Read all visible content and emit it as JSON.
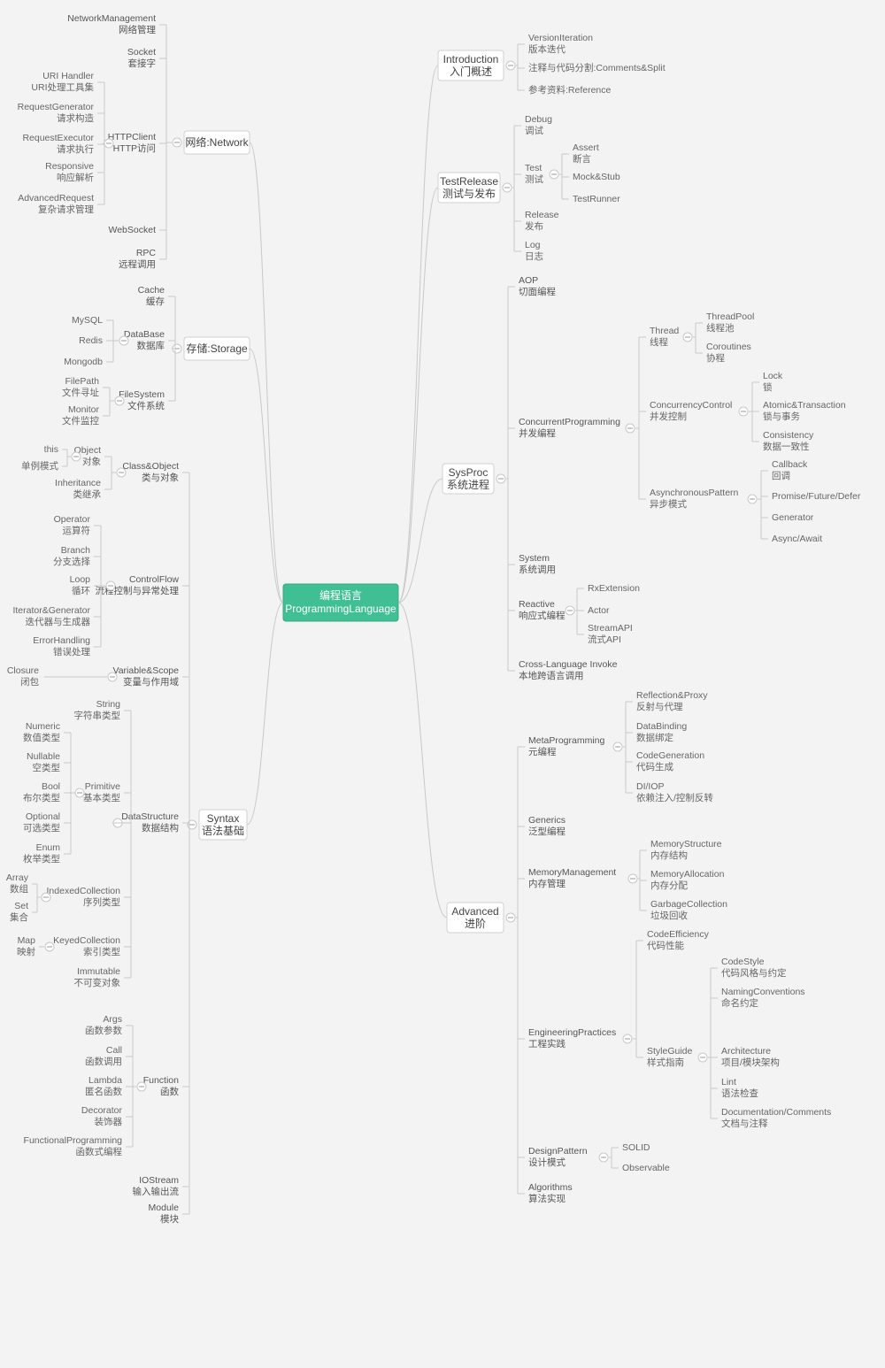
{
  "root": {
    "l1": "编程语言",
    "l2": "ProgrammingLanguage"
  },
  "left": {
    "network": {
      "l1": "网络:Network",
      "children": [
        {
          "l1": "NetworkManagement",
          "l2": "网络管理"
        },
        {
          "l1": "Socket",
          "l2": "套接字"
        },
        {
          "l1": "HTTPClient",
          "l2": "HTTP访问",
          "children": [
            {
              "l1": "URI Handler",
              "l2": "URI处理工具集"
            },
            {
              "l1": "RequestGenerator",
              "l2": "请求构造"
            },
            {
              "l1": "RequestExecutor",
              "l2": "请求执行"
            },
            {
              "l1": "Responsive",
              "l2": "响应解析"
            },
            {
              "l1": "AdvancedRequest",
              "l2": "复杂请求管理"
            }
          ]
        },
        {
          "l1": "WebSocket"
        },
        {
          "l1": "RPC",
          "l2": "远程调用"
        }
      ]
    },
    "storage": {
      "l1": "存储:Storage",
      "children": [
        {
          "l1": "Cache",
          "l2": "缓存"
        },
        {
          "l1": "DataBase",
          "l2": "数据库",
          "children": [
            {
              "l1": "MySQL"
            },
            {
              "l1": "Redis"
            },
            {
              "l1": "Mongodb"
            }
          ]
        },
        {
          "l1": "FileSystem",
          "l2": "文件系统",
          "children": [
            {
              "l1": "FilePath",
              "l2": "文件寻址"
            },
            {
              "l1": "Monitor",
              "l2": "文件监控"
            }
          ]
        }
      ]
    },
    "syntax": {
      "l1": "Syntax",
      "l2": "语法基础",
      "children": [
        {
          "l1": "Class&Object",
          "l2": "类与对象",
          "children": [
            {
              "l1": "Object",
              "l2": "对象",
              "children": [
                {
                  "l1": "this"
                },
                {
                  "l1": "单例模式"
                }
              ]
            },
            {
              "l1": "Inheritance",
              "l2": "类继承"
            }
          ]
        },
        {
          "l1": "ControlFlow",
          "l2": "流程控制与异常处理",
          "children": [
            {
              "l1": "Operator",
              "l2": "运算符"
            },
            {
              "l1": "Branch",
              "l2": "分支选择"
            },
            {
              "l1": "Loop",
              "l2": "循环"
            },
            {
              "l1": "Iterator&Generator",
              "l2": "迭代器与生成器"
            },
            {
              "l1": "ErrorHandling",
              "l2": "错误处理"
            }
          ]
        },
        {
          "l1": "Variable&Scope",
          "l2": "变量与作用域",
          "children": [
            {
              "l1": "Closure",
              "l2": "闭包"
            }
          ]
        },
        {
          "l1": "DataStructure",
          "l2": "数据结构",
          "children": [
            {
              "l1": "String",
              "l2": "字符串类型"
            },
            {
              "l1": "Primitive",
              "l2": "基本类型",
              "children": [
                {
                  "l1": "Numeric",
                  "l2": "数值类型"
                },
                {
                  "l1": "Nullable",
                  "l2": "空类型"
                },
                {
                  "l1": "Bool",
                  "l2": "布尔类型"
                },
                {
                  "l1": "Optional",
                  "l2": "可选类型"
                },
                {
                  "l1": "Enum",
                  "l2": "枚举类型"
                }
              ]
            },
            {
              "l1": "IndexedCollection",
              "l2": "序列类型",
              "children": [
                {
                  "l1": "Array",
                  "l2": "数组"
                },
                {
                  "l1": "Set",
                  "l2": "集合"
                }
              ]
            },
            {
              "l1": "KeyedCollection",
              "l2": "索引类型",
              "children": [
                {
                  "l1": "Map",
                  "l2": "映射"
                }
              ]
            },
            {
              "l1": "Immutable",
              "l2": "不可变对象"
            }
          ]
        },
        {
          "l1": "Function",
          "l2": "函数",
          "children": [
            {
              "l1": "Args",
              "l2": "函数参数"
            },
            {
              "l1": "Call",
              "l2": "函数调用"
            },
            {
              "l1": "Lambda",
              "l2": "匿名函数"
            },
            {
              "l1": "Decorator",
              "l2": "装饰器"
            },
            {
              "l1": "FunctionalProgramming",
              "l2": "函数式编程"
            }
          ]
        },
        {
          "l1": "IOStream",
          "l2": "输入输出流"
        },
        {
          "l1": "Module",
          "l2": "模块"
        }
      ]
    }
  },
  "right": {
    "introduction": {
      "l1": "Introduction",
      "l2": "入门概述",
      "children": [
        {
          "l1": "VersionIteration",
          "l2": "版本迭代"
        },
        {
          "l1": "注释与代码分割:Comments&Split"
        },
        {
          "l1": "参考资料:Reference"
        }
      ]
    },
    "testrelease": {
      "l1": "TestRelease",
      "l2": "测试与发布",
      "children": [
        {
          "l1": "Debug",
          "l2": "调试"
        },
        {
          "l1": "Test",
          "l2": "测试",
          "children": [
            {
              "l1": "Assert",
              "l2": "断言"
            },
            {
              "l1": "Mock&Stub"
            },
            {
              "l1": "TestRunner"
            }
          ]
        },
        {
          "l1": "Release",
          "l2": "发布"
        },
        {
          "l1": "Log",
          "l2": "日志"
        }
      ]
    },
    "sysproc": {
      "l1": "SysProc",
      "l2": "系统进程",
      "children": [
        {
          "l1": "AOP",
          "l2": "切面编程"
        },
        {
          "l1": "ConcurrentProgramming",
          "l2": "并发编程",
          "children": [
            {
              "l1": "Thread",
              "l2": "线程",
              "children": [
                {
                  "l1": "ThreadPool",
                  "l2": "线程池"
                },
                {
                  "l1": "Coroutines",
                  "l2": "协程"
                }
              ]
            },
            {
              "l1": "ConcurrencyControl",
              "l2": "并发控制",
              "children": [
                {
                  "l1": "Lock",
                  "l2": "锁"
                },
                {
                  "l1": "Atomic&Transaction",
                  "l2": "锁与事务"
                },
                {
                  "l1": "Consistency",
                  "l2": "数据一致性"
                }
              ]
            },
            {
              "l1": "AsynchronousPattern",
              "l2": "异步模式",
              "children": [
                {
                  "l1": "Callback",
                  "l2": "回调"
                },
                {
                  "l1": "Promise/Future/Defer"
                },
                {
                  "l1": "Generator"
                },
                {
                  "l1": "Async/Await"
                }
              ]
            }
          ]
        },
        {
          "l1": "System",
          "l2": "系统调用"
        },
        {
          "l1": "Reactive",
          "l2": "响应式编程",
          "children": [
            {
              "l1": "RxExtension"
            },
            {
              "l1": "Actor"
            },
            {
              "l1": "StreamAPI",
              "l2": "流式API"
            }
          ]
        },
        {
          "l1": "Cross-Language Invoke",
          "l2": "本地跨语言调用"
        }
      ]
    },
    "advanced": {
      "l1": "Advanced",
      "l2": "进阶",
      "children": [
        {
          "l1": "MetaProgramming",
          "l2": "元编程",
          "children": [
            {
              "l1": "Reflection&Proxy",
              "l2": "反射与代理"
            },
            {
              "l1": "DataBinding",
              "l2": "数据绑定"
            },
            {
              "l1": "CodeGeneration",
              "l2": "代码生成"
            },
            {
              "l1": "DI/IOP",
              "l2": "依赖注入/控制反转"
            }
          ]
        },
        {
          "l1": "Generics",
          "l2": "泛型编程"
        },
        {
          "l1": "MemoryManagement",
          "l2": "内存管理",
          "children": [
            {
              "l1": "MemoryStructure",
              "l2": "内存结构"
            },
            {
              "l1": "MemoryAllocation",
              "l2": "内存分配"
            },
            {
              "l1": "GarbageCollection",
              "l2": "垃圾回收"
            }
          ]
        },
        {
          "l1": "EngineeringPractices",
          "l2": "工程实践",
          "children": [
            {
              "l1": "CodeEfficiency",
              "l2": "代码性能"
            },
            {
              "l1": "StyleGuide",
              "l2": "样式指南",
              "children": [
                {
                  "l1": "CodeStyle",
                  "l2": "代码风格与约定"
                },
                {
                  "l1": "NamingConventions",
                  "l2": "命名约定"
                },
                {
                  "l1": "Architecture",
                  "l2": "项目/模块架构"
                },
                {
                  "l1": "Lint",
                  "l2": "语法检查"
                },
                {
                  "l1": "Documentation/Comments",
                  "l2": "文档与注释"
                }
              ]
            }
          ]
        },
        {
          "l1": "DesignPattern",
          "l2": "设计模式",
          "children": [
            {
              "l1": "SOLID"
            },
            {
              "l1": "Observable"
            }
          ]
        },
        {
          "l1": "Algorithms",
          "l2": "算法实现"
        }
      ]
    }
  },
  "chart_data": {
    "type": "mindmap",
    "root": "编程语言 / ProgrammingLanguage",
    "main_branches": [
      "网络:Network",
      "存储:Storage",
      "Syntax 语法基础",
      "Introduction 入门概述",
      "TestRelease 测试与发布",
      "SysProc 系统进程",
      "Advanced 进阶"
    ]
  }
}
